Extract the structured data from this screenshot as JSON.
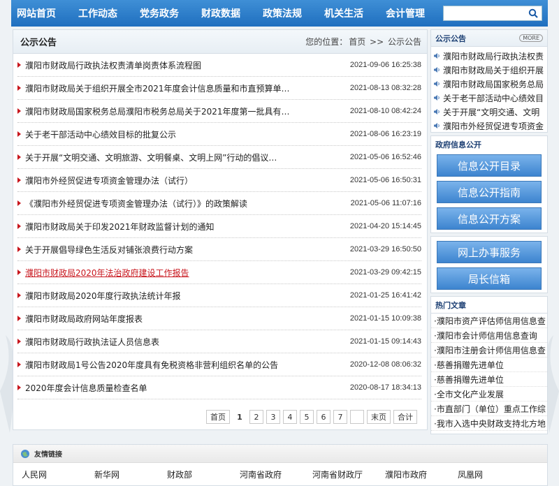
{
  "nav": {
    "items": [
      "网站首页",
      "工作动态",
      "党务政务",
      "财政数据",
      "政策法规",
      "机关生活",
      "会计管理"
    ],
    "search_placeholder": ""
  },
  "main": {
    "title": "公示公告",
    "breadcrumb": {
      "label": "您的位置：",
      "home": "首页",
      "sep": ">>",
      "current": "公示公告"
    },
    "rows": [
      {
        "title": "濮阳市财政局行政执法权责清单岗责体系流程图",
        "date": "2021-09-06 16:25:38",
        "highlight": false
      },
      {
        "title": "濮阳市财政局关于组织开展全市2021年度会计信息质量和市直预算单…",
        "date": "2021-08-13 08:32:28",
        "highlight": false
      },
      {
        "title": "濮阳市财政局国家税务总局濮阳市税务总局关于2021年度第一批具有…",
        "date": "2021-08-10 08:42:24",
        "highlight": false
      },
      {
        "title": "关于老干部活动中心绩效目标的批复公示",
        "date": "2021-08-06 16:23:19",
        "highlight": false
      },
      {
        "title": "关于开展“文明交通、文明旅游、文明餐桌、文明上网”行动的倡议…",
        "date": "2021-05-06 16:52:46",
        "highlight": false
      },
      {
        "title": "濮阳市外经贸促进专项资金管理办法（试行）",
        "date": "2021-05-06 16:50:31",
        "highlight": false
      },
      {
        "title": "《濮阳市外经贸促进专项资金管理办法（试行）》的政策解读",
        "date": "2021-05-06 11:07:16",
        "highlight": false
      },
      {
        "title": "濮阳市财政局关于印发2021年财政监督计划的通知",
        "date": "2021-04-20 15:14:45",
        "highlight": false
      },
      {
        "title": "关于开展倡导绿色生活反对铺张浪费行动方案",
        "date": "2021-03-29 16:50:50",
        "highlight": false
      },
      {
        "title": "濮阳市财政局2020年法治政府建设工作报告",
        "date": "2021-03-29 09:42:15",
        "highlight": true
      },
      {
        "title": "濮阳市财政局2020年度行政执法统计年报",
        "date": "2021-01-25 16:41:42",
        "highlight": false
      },
      {
        "title": "濮阳市财政局政府网站年度报表",
        "date": "2021-01-15 10:09:38",
        "highlight": false
      },
      {
        "title": "濮阳市财政局行政执法证人员信息表",
        "date": "2021-01-15 09:14:43",
        "highlight": false
      },
      {
        "title": "濮阳市财政局1号公告2020年度具有免税资格非营利组织名单的公告",
        "date": "2020-12-08 08:06:32",
        "highlight": false
      },
      {
        "title": "2020年度会计信息质量检查名单",
        "date": "2020-08-17 18:34:13",
        "highlight": false
      }
    ],
    "pager": {
      "first": "首页",
      "pages": [
        "1",
        "2",
        "3",
        "4",
        "5",
        "6",
        "7"
      ],
      "blank": "",
      "last": "末页",
      "total": "合计",
      "current": "1"
    }
  },
  "side": {
    "notice": {
      "title": "公示公告",
      "more": "MORE",
      "items": [
        "濮阳市财政局行政执法权责",
        "濮阳市财政局关于组织开展",
        "濮阳市财政局国家税务总局",
        "关于老干部活动中心绩效目",
        "关于开展“文明交通、文明",
        "濮阳市外经贸促进专项资金"
      ]
    },
    "gov": {
      "title": "政府信息公开",
      "buttons": [
        "信息公开目录",
        "信息公开指南",
        "信息公开方案"
      ]
    },
    "service": {
      "buttons": [
        "网上办事服务",
        "局长信箱"
      ]
    },
    "hot": {
      "title": "热门文章",
      "items": [
        "·濮阳市资产评估师信用信息查",
        "·濮阳市会计师信用信息查询",
        "·濮阳市注册会计师信用信息查",
        "·慈善捐赠先进单位",
        "·慈善捐赠先进单位",
        "·全市文化产业发展",
        "·市直部门（单位）重点工作综",
        "·我市入选中央财政支持北方地"
      ]
    }
  },
  "friends": {
    "title": "友情链接",
    "links": [
      "人民网",
      "新华网",
      "财政部",
      "河南省政府",
      "河南省财政厅",
      "濮阳市政府",
      "凤凰网"
    ]
  },
  "colors": {
    "nav": "#2a7bcb",
    "accent": "#c8161d",
    "button": "#4a90d9"
  }
}
